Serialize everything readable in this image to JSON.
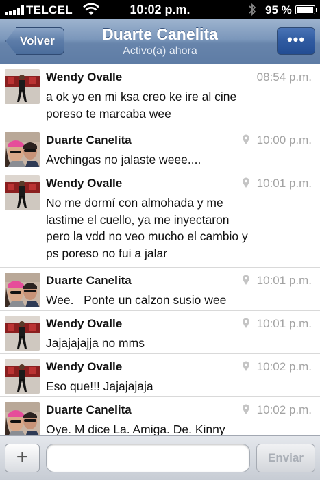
{
  "status_bar": {
    "carrier": "TELCEL",
    "time": "10:02 p.m.",
    "battery_percent": "95 %",
    "battery_level": 0.95
  },
  "nav": {
    "back_label": "Volver",
    "title": "Duarte Canelita",
    "subtitle": "Activo(a) ahora",
    "more_label": "•••"
  },
  "messages": [
    {
      "sender": "Wendy Ovalle",
      "time": "08:54 p.m.",
      "has_location_icon": false,
      "avatar": "wendy-avatar",
      "text": "a ok yo en mi ksa creo ke ire al cine\nporeso te marcaba wee"
    },
    {
      "sender": "Duarte Canelita",
      "time": "10:00 p.m.",
      "has_location_icon": true,
      "avatar": "duarte-avatar",
      "text": "Avchingas no jalaste weee...."
    },
    {
      "sender": "Wendy Ovalle",
      "time": "10:01 p.m.",
      "has_location_icon": true,
      "avatar": "wendy-avatar",
      "text": "No me dormí con almohada y me\nlastime el cuello, ya me inyectaron\npero la vdd no veo mucho el cambio y\nps poreso no fui a jalar"
    },
    {
      "sender": "Duarte Canelita",
      "time": "10:01 p.m.",
      "has_location_icon": true,
      "avatar": "duarte-avatar",
      "text": "Wee.   Ponte un calzon susio wee"
    },
    {
      "sender": "Wendy Ovalle",
      "time": "10:01 p.m.",
      "has_location_icon": true,
      "avatar": "wendy-avatar",
      "text": "Jajajajajja no mms"
    },
    {
      "sender": "Wendy Ovalle",
      "time": "10:02 p.m.",
      "has_location_icon": true,
      "avatar": "wendy-avatar",
      "text": "Eso que!!! Jajajajaja"
    },
    {
      "sender": "Duarte Canelita",
      "time": "10:02 p.m.",
      "has_location_icon": true,
      "avatar": "duarte-avatar",
      "text": "Oye. M dice La. Amiga. De. Kinny"
    }
  ],
  "composer": {
    "plus_label": "+",
    "input_value": "",
    "send_label": "Enviar"
  },
  "colors": {
    "nav_blue": "#6784ab",
    "send_disabled_text": "#a9aeb6"
  }
}
